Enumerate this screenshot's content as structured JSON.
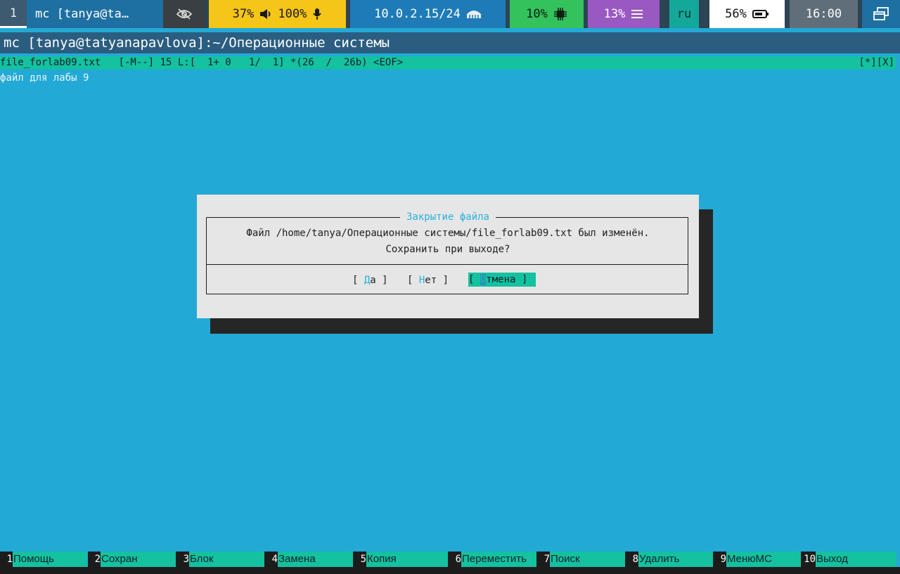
{
  "topbar": {
    "workspace": "1",
    "window_title": "mc [tanya@ta…",
    "privacy_icon": "eye-off-icon",
    "volume": "37%",
    "volume_icon": "speaker-icon",
    "mic": "100%",
    "mic_icon": "microphone-icon",
    "ip": "10.0.2.15/24",
    "network_icon": "ethernet-icon",
    "cpu": "10%",
    "cpu_icon": "chip-icon",
    "memory": "13%",
    "memory_icon": "memory-icon",
    "layout": "ru",
    "battery": "56%",
    "battery_icon": "battery-icon",
    "clock": "16:00",
    "windows_icon": "windows-icon"
  },
  "terminal_title": "mc [tanya@tatyanapavlova]:~/Операционные системы",
  "editor": {
    "status_left": "file_forlab09.txt   [-M--] 15 L:[  1+ 0   1/  1] *(26  /  26b) <EOF>",
    "status_right": "[*][X]",
    "content_line": "файл для лабы 9"
  },
  "dialog": {
    "title": "Закрытие файла",
    "message_line1": "Файл /home/tanya/Операционные системы/file_forlab09.txt был изменён.",
    "message_line2": "Сохранить при выходе?",
    "yes_hot": "Д",
    "yes_rest": "а",
    "no_hot": "Н",
    "no_rest": "ет",
    "cancel_cursor": "О",
    "cancel_rest": "тмена"
  },
  "fkeys": [
    {
      "num": "1",
      "label": "Помощь"
    },
    {
      "num": "2",
      "label": "Сохран"
    },
    {
      "num": "3",
      "label": "Блок"
    },
    {
      "num": "4",
      "label": "Замена"
    },
    {
      "num": "5",
      "label": "Копия"
    },
    {
      "num": "6",
      "label": "Переместить"
    },
    {
      "num": "7",
      "label": "Поиск"
    },
    {
      "num": "8",
      "label": "Удалить"
    },
    {
      "num": "9",
      "label": "МенюMC"
    },
    {
      "num": "10",
      "label": "Выход"
    }
  ],
  "colors": {
    "background": "#23a9d5",
    "accent_bar": "#14c1a0",
    "dialog_bg": "#e6e6e6",
    "dialog_title": "#2bb0dd"
  }
}
